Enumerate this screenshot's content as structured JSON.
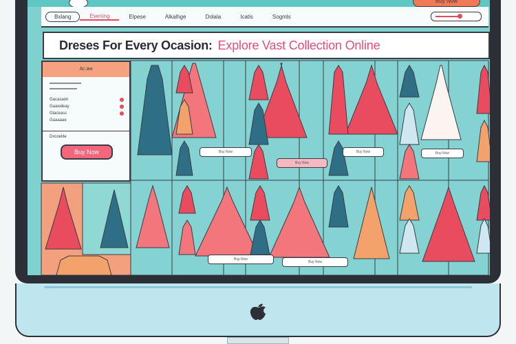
{
  "nav": {
    "items": [
      "Bxlang",
      "Evening",
      "Elpese",
      "Alkalhge",
      "Dolala",
      "Icatis",
      "Sogmls"
    ],
    "active_index": 1,
    "top_button": "Buy Now"
  },
  "headline": {
    "dark": "Dreses For Every Ocasion:",
    "pink": "Explore Vast Collection Online"
  },
  "side": {
    "header": "Ac.aw",
    "rows": [
      "Gacasaon",
      "Gaawdeay",
      "Glaceass",
      "Gaaaaae"
    ],
    "sub": "Dxcoelite",
    "button": "Buy Now"
  },
  "tags": [
    "Buy Now",
    "Buy Now",
    "Buy Now",
    "Buy Now",
    "Buy Now",
    "Buy Now"
  ],
  "colors": {
    "screen_bg": "#7fd1cf",
    "accent_pink": "#e54b7a",
    "accent_red": "#f4667b",
    "bezel": "#2d2f36",
    "chin": "#bfe6ef"
  },
  "logo_icon": "apple-logo-icon"
}
